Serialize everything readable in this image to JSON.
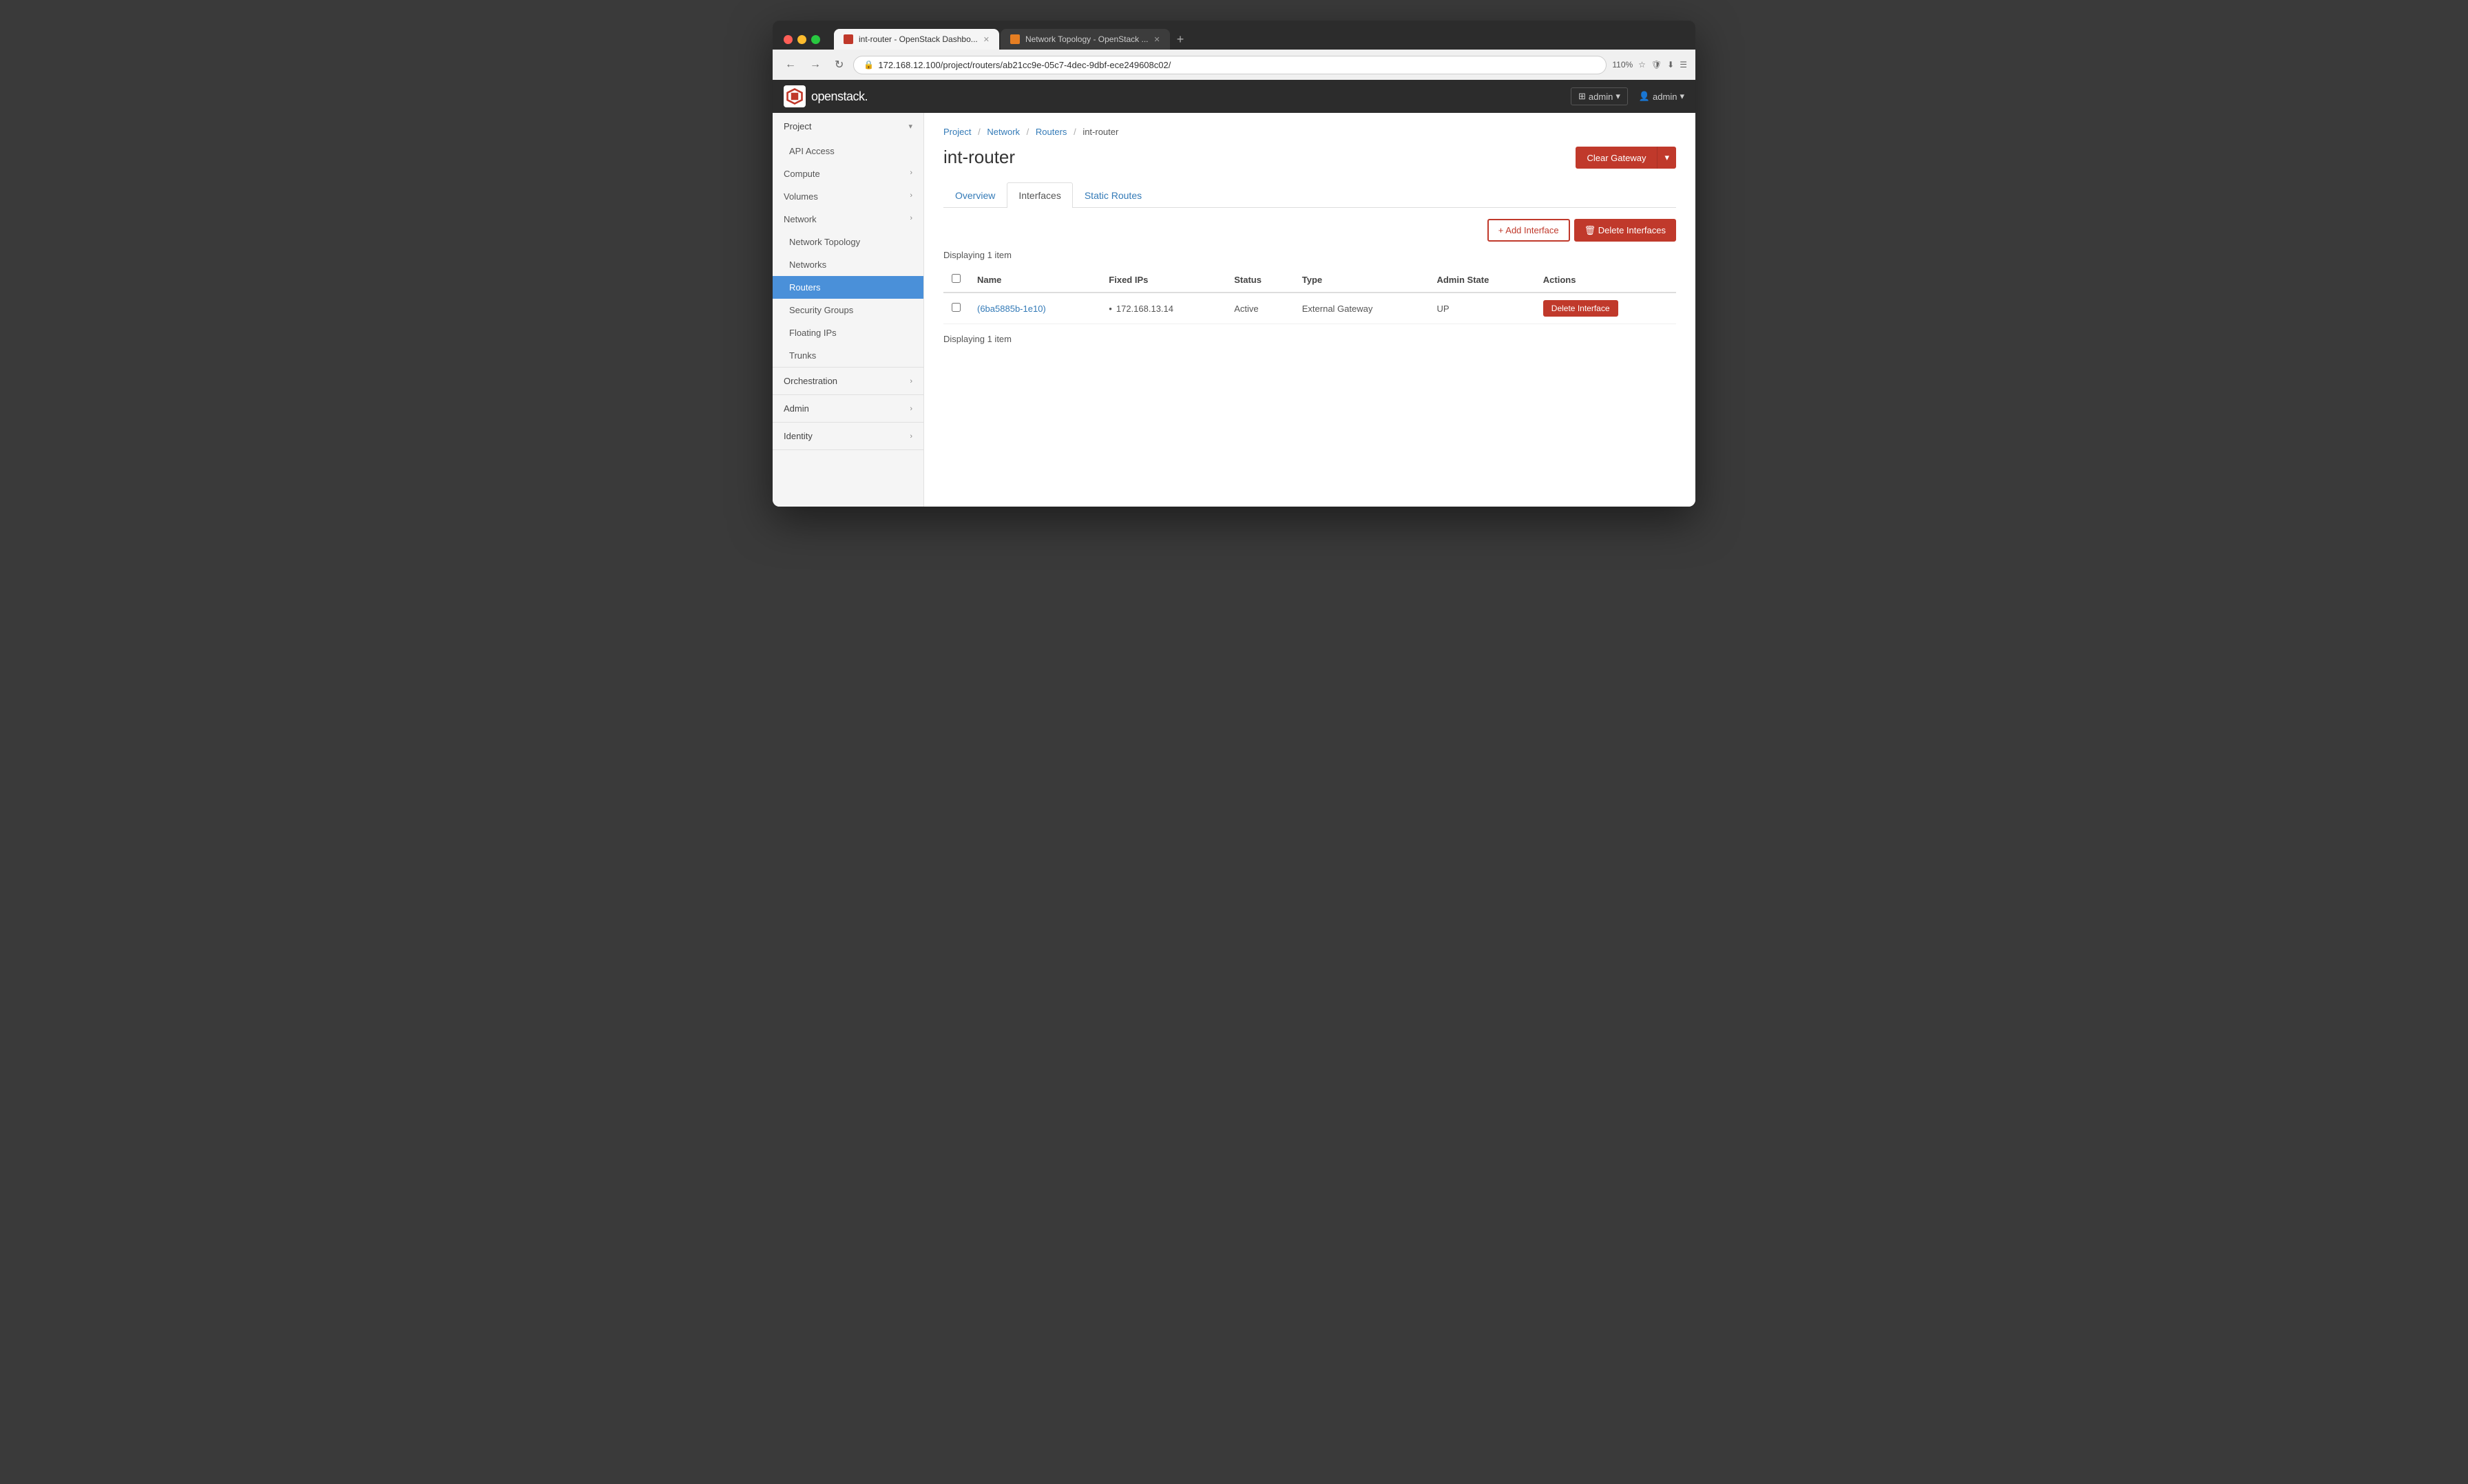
{
  "browser": {
    "tabs": [
      {
        "id": "tab1",
        "label": "int-router - OpenStack Dashbo...",
        "favicon_color": "#c0392b",
        "active": true
      },
      {
        "id": "tab2",
        "label": "Network Topology - OpenStack ...",
        "favicon_color": "#e67e22",
        "active": false
      }
    ],
    "address": "172.168.12.100/project/routers/ab21cc9e-05c7-4dec-9dbf-ece249608c02/",
    "zoom": "110%"
  },
  "topnav": {
    "brand": "openstack.",
    "project_label": "admin",
    "user_label": "admin"
  },
  "sidebar": {
    "sections": [
      {
        "id": "project",
        "label": "Project",
        "expanded": true,
        "items": [
          {
            "id": "api-access",
            "label": "API Access",
            "indent": 1,
            "active": false
          },
          {
            "id": "compute",
            "label": "Compute",
            "indent": 0,
            "has_children": true,
            "active": false
          },
          {
            "id": "volumes",
            "label": "Volumes",
            "indent": 0,
            "has_children": true,
            "active": false
          },
          {
            "id": "network",
            "label": "Network",
            "indent": 0,
            "has_children": true,
            "active": false,
            "expanded": true
          },
          {
            "id": "network-topology",
            "label": "Network Topology",
            "indent": 1,
            "active": false
          },
          {
            "id": "networks",
            "label": "Networks",
            "indent": 1,
            "active": false
          },
          {
            "id": "routers",
            "label": "Routers",
            "indent": 1,
            "active": true
          },
          {
            "id": "security-groups",
            "label": "Security Groups",
            "indent": 1,
            "active": false
          },
          {
            "id": "floating-ips",
            "label": "Floating IPs",
            "indent": 1,
            "active": false
          },
          {
            "id": "trunks",
            "label": "Trunks",
            "indent": 1,
            "active": false
          }
        ]
      },
      {
        "id": "orchestration",
        "label": "Orchestration",
        "expanded": false,
        "items": []
      },
      {
        "id": "admin",
        "label": "Admin",
        "expanded": false,
        "items": []
      },
      {
        "id": "identity",
        "label": "Identity",
        "expanded": false,
        "items": []
      }
    ]
  },
  "breadcrumb": {
    "items": [
      {
        "label": "Project",
        "link": true
      },
      {
        "label": "Network",
        "link": true
      },
      {
        "label": "Routers",
        "link": true
      },
      {
        "label": "int-router",
        "link": false
      }
    ]
  },
  "page": {
    "title": "int-router",
    "clear_gateway_label": "Clear Gateway",
    "caret_label": "▾"
  },
  "tabs": [
    {
      "id": "overview",
      "label": "Overview",
      "active": false
    },
    {
      "id": "interfaces",
      "label": "Interfaces",
      "active": true
    },
    {
      "id": "static-routes",
      "label": "Static Routes",
      "active": false
    }
  ],
  "table_toolbar": {
    "add_interface_label": "+ Add Interface",
    "delete_interfaces_label": "🗑 Delete Interfaces"
  },
  "table": {
    "displaying_text_top": "Displaying 1 item",
    "displaying_text_bottom": "Displaying 1 item",
    "columns": [
      "Name",
      "Fixed IPs",
      "Status",
      "Type",
      "Admin State",
      "Actions"
    ],
    "rows": [
      {
        "id": "row1",
        "name": "(6ba5885b-1e10)",
        "fixed_ip": "172.168.13.14",
        "status": "Active",
        "type": "External Gateway",
        "admin_state": "UP",
        "action": "Delete Interface"
      }
    ]
  }
}
